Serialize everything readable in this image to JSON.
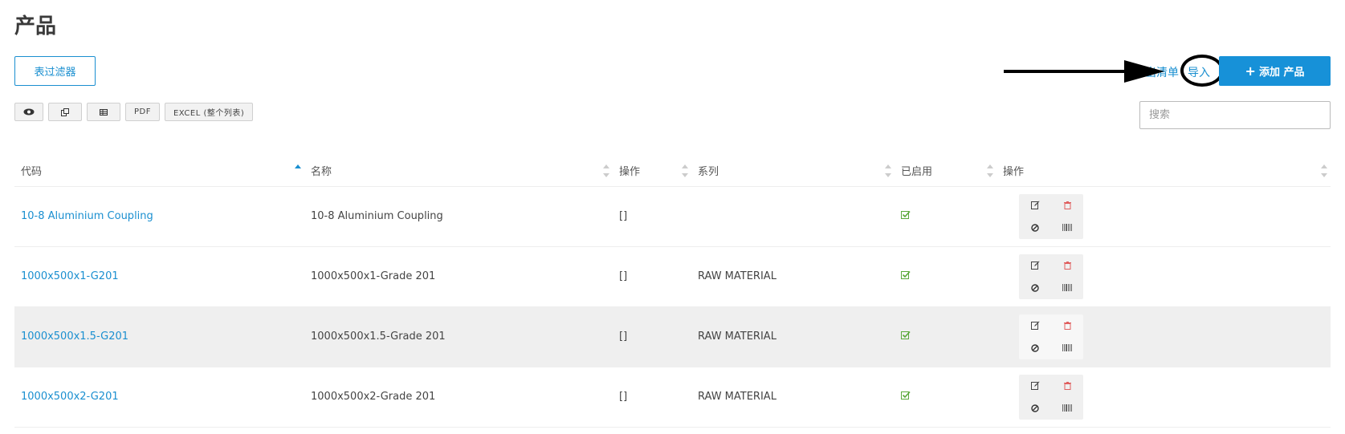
{
  "page": {
    "title": "产品"
  },
  "toolbar": {
    "filter_label": "表过滤器",
    "export_label": "导出清单",
    "import_label": "导入",
    "add_label": "添加 产品",
    "search_placeholder": "搜索",
    "tool_buttons": [
      {
        "icon": "eye-icon"
      },
      {
        "icon": "copy-icon"
      },
      {
        "icon": "table-icon"
      },
      {
        "label": "PDF"
      },
      {
        "label": "EXCEL (整个列表)"
      }
    ]
  },
  "table": {
    "headers": [
      "代码",
      "名称",
      "操作",
      "系列",
      "已启用",
      "操作"
    ],
    "rows": [
      {
        "code": "10-8 Aluminium Coupling",
        "name": "10-8 Aluminium Coupling",
        "ops": "[]",
        "series": ""
      },
      {
        "code": "1000x500x1-G201",
        "name": "1000x500x1-Grade 201",
        "ops": "[]",
        "series": "RAW MATERIAL"
      },
      {
        "code": "1000x500x1.5-G201",
        "name": "1000x500x1.5-Grade 201",
        "ops": "[]",
        "series": "RAW MATERIAL"
      },
      {
        "code": "1000x500x2-G201",
        "name": "1000x500x2-Grade 201",
        "ops": "[]",
        "series": "RAW MATERIAL"
      }
    ]
  },
  "colors": {
    "accent": "#1791d8",
    "link": "#1a8fd0",
    "enabled": "#5aa83a",
    "delete": "#e06060"
  }
}
